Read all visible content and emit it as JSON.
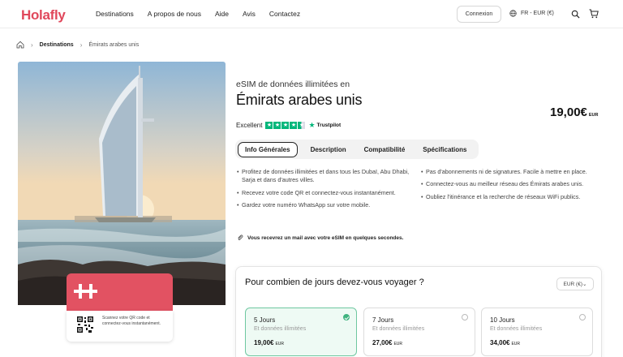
{
  "header": {
    "logo": "Holafly",
    "nav": [
      "Destinations",
      "A propos de nous",
      "Aide",
      "Avis",
      "Contactez"
    ],
    "login_label": "Connexion",
    "language_label": "FR - EUR (€)"
  },
  "breadcrumb": {
    "items": [
      "Destinations",
      "Émirats arabes unis"
    ]
  },
  "hero_card": {
    "qr_text": "Scannez votre QR code et connectez-vous instantanément."
  },
  "product": {
    "subtitle": "eSIM de données illimitées en",
    "title": "Émirats arabes unis",
    "price": "19,00€",
    "price_currency": "EUR",
    "rating_label": "Excellent",
    "rating_stars": 4.5,
    "trustpilot_label": "Trustpilot"
  },
  "tabs": [
    "Info Générales",
    "Description",
    "Compatibilité",
    "Spécifications"
  ],
  "features_left": [
    "Profitez de données illimitées et dans tous les Dubaï, Abu Dhabi, Sarja et dans d'autres villes.",
    "Recevez votre code QR et connectez-vous instantanément.",
    "Gardez votre numéro WhatsApp sur votre mobile."
  ],
  "features_right": [
    "Pas d'abonnements ni de signatures. Facile à mettre en place.",
    "Connectez-vous au meilleur réseau des Émirats arabes unis.",
    "Oubliez l'itinérance et la recherche de réseaux WiFi publics."
  ],
  "mail_note": "Vous recevrez un mail avec votre eSIM en quelques secondes.",
  "plans": {
    "question": "Pour combien de jours devez-vous voyager ?",
    "currency_select": "EUR (€)",
    "options": [
      {
        "days": "5 Jours",
        "data": "Et données illimitées",
        "price": "19,00€",
        "currency": "EUR",
        "selected": true
      },
      {
        "days": "7 Jours",
        "data": "Et données illimitées",
        "price": "27,00€",
        "currency": "EUR",
        "selected": false
      },
      {
        "days": "10 Jours",
        "data": "Et données illimitées",
        "price": "34,00€",
        "currency": "EUR",
        "selected": false
      }
    ]
  },
  "colors": {
    "brand": "#e0475b",
    "trustpilot": "#00b67a",
    "selected_border": "#6ec7a0",
    "selected_bg": "#eefaf4"
  }
}
